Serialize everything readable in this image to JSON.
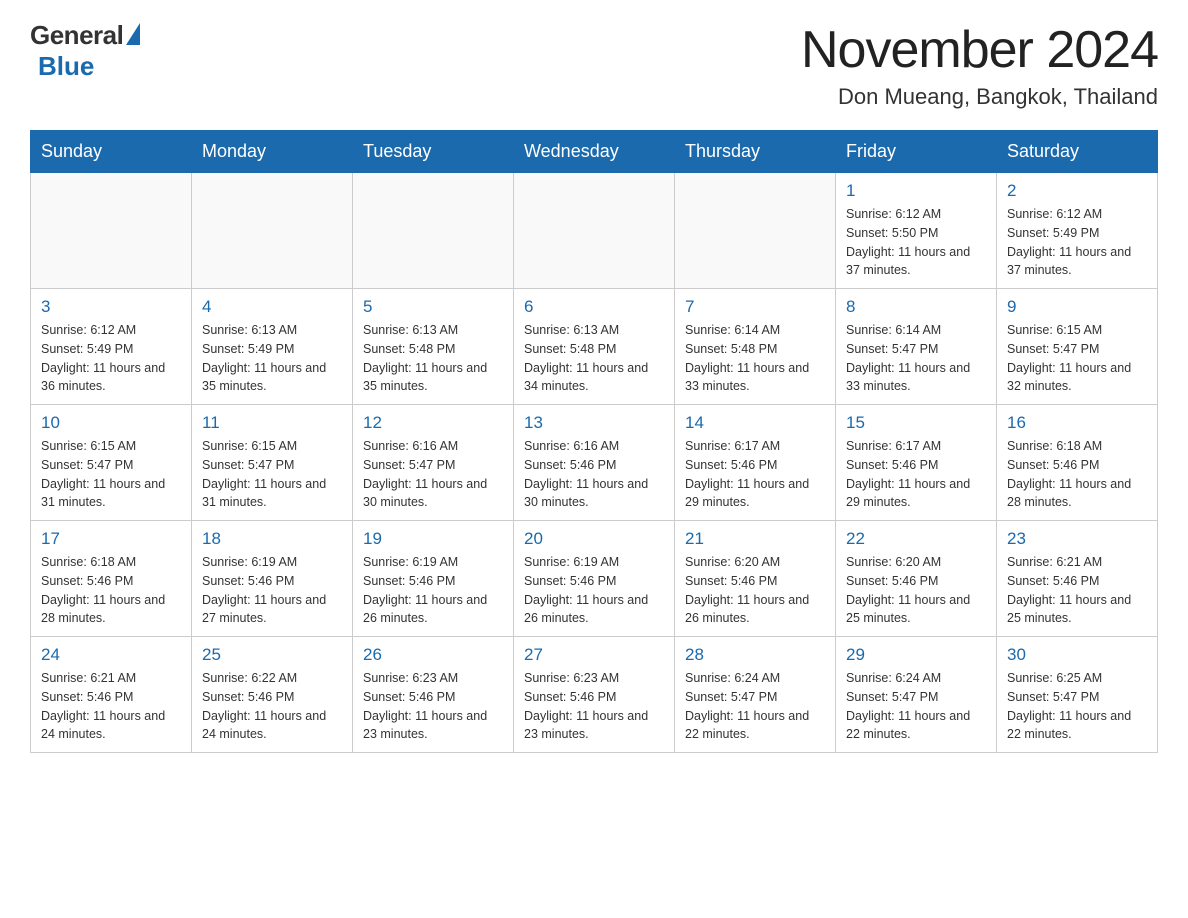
{
  "header": {
    "logo_general": "General",
    "logo_blue": "Blue",
    "month_title": "November 2024",
    "location": "Don Mueang, Bangkok, Thailand"
  },
  "days_of_week": [
    "Sunday",
    "Monday",
    "Tuesday",
    "Wednesday",
    "Thursday",
    "Friday",
    "Saturday"
  ],
  "weeks": [
    [
      {
        "day": "",
        "info": ""
      },
      {
        "day": "",
        "info": ""
      },
      {
        "day": "",
        "info": ""
      },
      {
        "day": "",
        "info": ""
      },
      {
        "day": "",
        "info": ""
      },
      {
        "day": "1",
        "info": "Sunrise: 6:12 AM\nSunset: 5:50 PM\nDaylight: 11 hours and 37 minutes."
      },
      {
        "day": "2",
        "info": "Sunrise: 6:12 AM\nSunset: 5:49 PM\nDaylight: 11 hours and 37 minutes."
      }
    ],
    [
      {
        "day": "3",
        "info": "Sunrise: 6:12 AM\nSunset: 5:49 PM\nDaylight: 11 hours and 36 minutes."
      },
      {
        "day": "4",
        "info": "Sunrise: 6:13 AM\nSunset: 5:49 PM\nDaylight: 11 hours and 35 minutes."
      },
      {
        "day": "5",
        "info": "Sunrise: 6:13 AM\nSunset: 5:48 PM\nDaylight: 11 hours and 35 minutes."
      },
      {
        "day": "6",
        "info": "Sunrise: 6:13 AM\nSunset: 5:48 PM\nDaylight: 11 hours and 34 minutes."
      },
      {
        "day": "7",
        "info": "Sunrise: 6:14 AM\nSunset: 5:48 PM\nDaylight: 11 hours and 33 minutes."
      },
      {
        "day": "8",
        "info": "Sunrise: 6:14 AM\nSunset: 5:47 PM\nDaylight: 11 hours and 33 minutes."
      },
      {
        "day": "9",
        "info": "Sunrise: 6:15 AM\nSunset: 5:47 PM\nDaylight: 11 hours and 32 minutes."
      }
    ],
    [
      {
        "day": "10",
        "info": "Sunrise: 6:15 AM\nSunset: 5:47 PM\nDaylight: 11 hours and 31 minutes."
      },
      {
        "day": "11",
        "info": "Sunrise: 6:15 AM\nSunset: 5:47 PM\nDaylight: 11 hours and 31 minutes."
      },
      {
        "day": "12",
        "info": "Sunrise: 6:16 AM\nSunset: 5:47 PM\nDaylight: 11 hours and 30 minutes."
      },
      {
        "day": "13",
        "info": "Sunrise: 6:16 AM\nSunset: 5:46 PM\nDaylight: 11 hours and 30 minutes."
      },
      {
        "day": "14",
        "info": "Sunrise: 6:17 AM\nSunset: 5:46 PM\nDaylight: 11 hours and 29 minutes."
      },
      {
        "day": "15",
        "info": "Sunrise: 6:17 AM\nSunset: 5:46 PM\nDaylight: 11 hours and 29 minutes."
      },
      {
        "day": "16",
        "info": "Sunrise: 6:18 AM\nSunset: 5:46 PM\nDaylight: 11 hours and 28 minutes."
      }
    ],
    [
      {
        "day": "17",
        "info": "Sunrise: 6:18 AM\nSunset: 5:46 PM\nDaylight: 11 hours and 28 minutes."
      },
      {
        "day": "18",
        "info": "Sunrise: 6:19 AM\nSunset: 5:46 PM\nDaylight: 11 hours and 27 minutes."
      },
      {
        "day": "19",
        "info": "Sunrise: 6:19 AM\nSunset: 5:46 PM\nDaylight: 11 hours and 26 minutes."
      },
      {
        "day": "20",
        "info": "Sunrise: 6:19 AM\nSunset: 5:46 PM\nDaylight: 11 hours and 26 minutes."
      },
      {
        "day": "21",
        "info": "Sunrise: 6:20 AM\nSunset: 5:46 PM\nDaylight: 11 hours and 26 minutes."
      },
      {
        "day": "22",
        "info": "Sunrise: 6:20 AM\nSunset: 5:46 PM\nDaylight: 11 hours and 25 minutes."
      },
      {
        "day": "23",
        "info": "Sunrise: 6:21 AM\nSunset: 5:46 PM\nDaylight: 11 hours and 25 minutes."
      }
    ],
    [
      {
        "day": "24",
        "info": "Sunrise: 6:21 AM\nSunset: 5:46 PM\nDaylight: 11 hours and 24 minutes."
      },
      {
        "day": "25",
        "info": "Sunrise: 6:22 AM\nSunset: 5:46 PM\nDaylight: 11 hours and 24 minutes."
      },
      {
        "day": "26",
        "info": "Sunrise: 6:23 AM\nSunset: 5:46 PM\nDaylight: 11 hours and 23 minutes."
      },
      {
        "day": "27",
        "info": "Sunrise: 6:23 AM\nSunset: 5:46 PM\nDaylight: 11 hours and 23 minutes."
      },
      {
        "day": "28",
        "info": "Sunrise: 6:24 AM\nSunset: 5:47 PM\nDaylight: 11 hours and 22 minutes."
      },
      {
        "day": "29",
        "info": "Sunrise: 6:24 AM\nSunset: 5:47 PM\nDaylight: 11 hours and 22 minutes."
      },
      {
        "day": "30",
        "info": "Sunrise: 6:25 AM\nSunset: 5:47 PM\nDaylight: 11 hours and 22 minutes."
      }
    ]
  ]
}
